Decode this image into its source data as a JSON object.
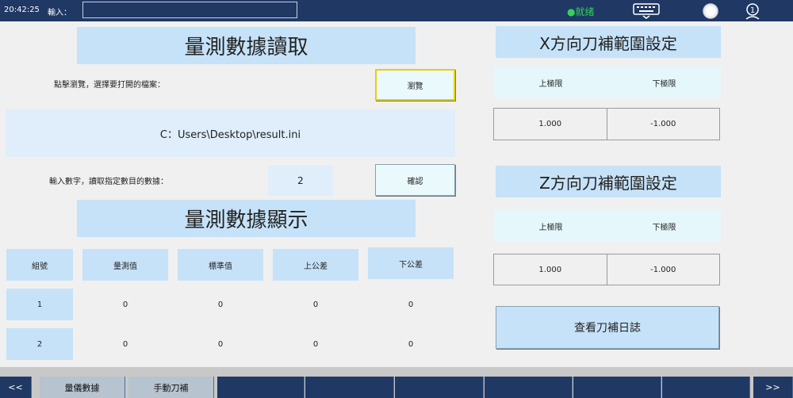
{
  "topbar": {
    "time": "20:42:25",
    "input_label": "輸入：",
    "input_value": "",
    "status": "●就绪"
  },
  "read_section": {
    "title": "量測數據讀取",
    "browse_prompt": "點擊瀏覽，選擇要打開的檔案：",
    "browse_button": "瀏覽",
    "file_path": "C：Users\\Desktop\\result.ini",
    "count_prompt": "輸入數字，讀取指定數目的數據：",
    "count_value": "2",
    "confirm_button": "確認"
  },
  "display_section": {
    "title": "量測數據顯示",
    "columns": [
      "組號",
      "量測值",
      "標準值",
      "上公差",
      "下公差"
    ],
    "rows": [
      [
        "1",
        "0",
        "0",
        "0",
        "0"
      ],
      [
        "2",
        "0",
        "0",
        "0",
        "0"
      ]
    ]
  },
  "x_range": {
    "title": "X方向刀補範圍設定",
    "upper_label": "上極限",
    "lower_label": "下極限",
    "upper_value": "1.000",
    "lower_value": "-1.000"
  },
  "z_range": {
    "title": "Z方向刀補範圍設定",
    "upper_label": "上極限",
    "lower_label": "下極限",
    "upper_value": "1.000",
    "lower_value": "-1.000"
  },
  "log_button": "查看刀補日誌",
  "bottom_tabs": {
    "prev": "<<",
    "tab1": "量儀數據",
    "tab2": "手動刀補",
    "next": ">>"
  },
  "colors": {
    "topbar": "#1f3864",
    "header_fill": "#c6e2f8",
    "status": "#32d25a",
    "focus_border": "#e6d000"
  }
}
